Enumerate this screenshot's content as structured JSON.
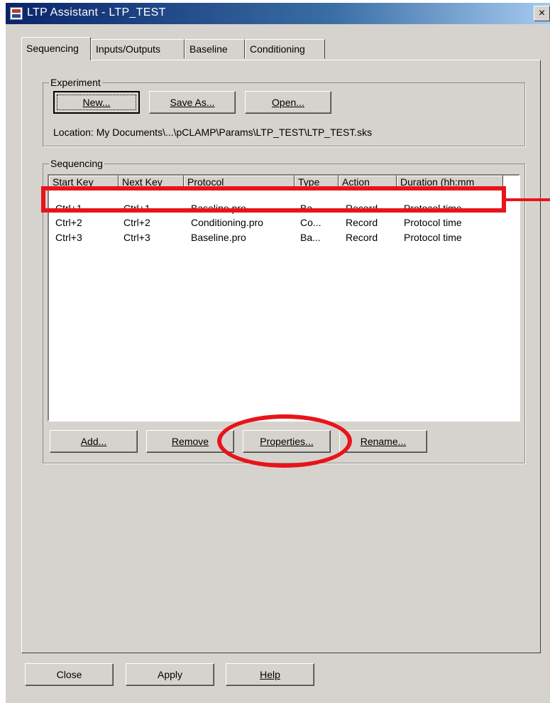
{
  "window": {
    "title": "LTP Assistant - LTP_TEST",
    "close_glyph": "×"
  },
  "tabs": [
    {
      "label": "Sequencing",
      "active": true
    },
    {
      "label": "Inputs/Outputs",
      "active": false
    },
    {
      "label": "Baseline",
      "active": false
    },
    {
      "label": "Conditioning",
      "active": false
    }
  ],
  "experiment": {
    "group_label": "Experiment",
    "new_label": "New...",
    "save_as_label": "Save As...",
    "open_label": "Open...",
    "location": "Location: My Documents\\...\\pCLAMP\\Params\\LTP_TEST\\LTP_TEST.sks"
  },
  "sequencing": {
    "group_label": "Sequencing",
    "columns": [
      "Start Key",
      "Next Key",
      "Protocol",
      "Type",
      "Action",
      "Duration (hh:mm"
    ],
    "rows": [
      [
        "Ctrl+1",
        "Ctrl+1",
        "Baseline.pro",
        "Ba...",
        "Record",
        "Protocol time"
      ],
      [
        "Ctrl+2",
        "Ctrl+2",
        "Conditioning.pro",
        "Co...",
        "Record",
        "Protocol time"
      ],
      [
        "Ctrl+3",
        "Ctrl+3",
        "Baseline.pro",
        "Ba...",
        "Record",
        "Protocol time"
      ]
    ],
    "add_label": "Add...",
    "remove_label": "Remove",
    "properties_label": "Properties...",
    "rename_label": "Rename..."
  },
  "footer": {
    "close_label": "Close",
    "apply_label": "Apply",
    "help_label": "Help"
  },
  "colors": {
    "annotation": "#e8141a",
    "face": "#d6d3ce",
    "title_bar": "#0a246a"
  }
}
